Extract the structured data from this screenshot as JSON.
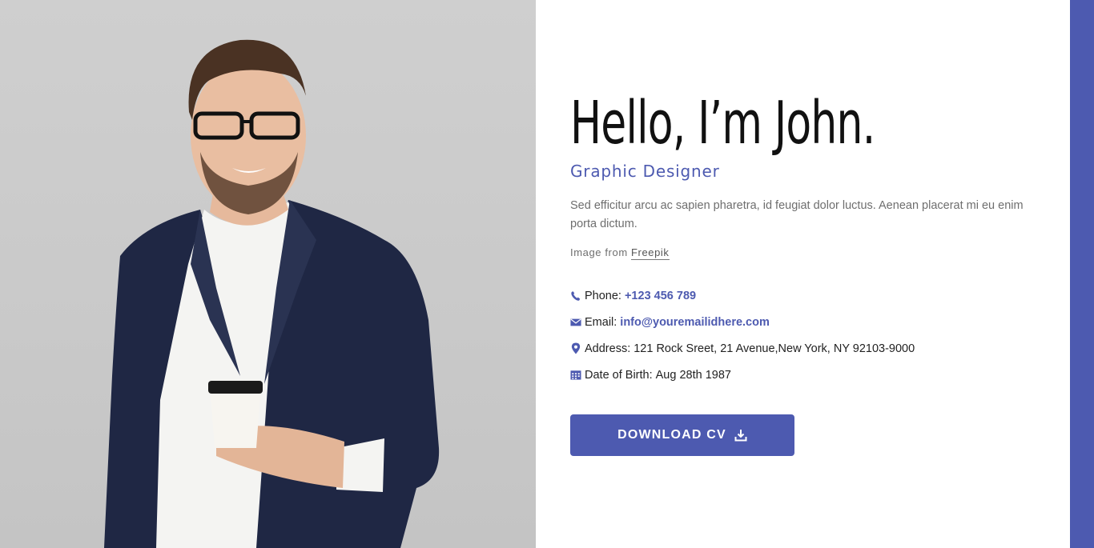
{
  "hero": {
    "title": "Hello, I’m John.",
    "subtitle": "Graphic Designer",
    "description": "Sed efficitur arcu ac sapien pharetra, id feugiat dolor luctus. Aenean placerat mi eu enim porta dictum.",
    "credit_prefix": "Image from",
    "credit_link": "Freepik"
  },
  "contact": {
    "phone_label": "Phone:",
    "phone_value": "+123 456 789",
    "email_label": "Email:",
    "email_value": "info@youremailidhere.com",
    "address_label": "Address:",
    "address_value": "121 Rock Sreet, 21 Avenue,New York, NY 92103-9000",
    "dob_label": "Date of Birth:",
    "dob_value": "Aug 28th 1987"
  },
  "actions": {
    "download_label": "DOWNLOAD CV"
  },
  "icons": {
    "phone": "phone-icon",
    "email": "envelope-icon",
    "address": "map-pin-icon",
    "dob": "calendar-icon",
    "download": "download-icon"
  },
  "colors": {
    "accent": "#4d5ab0",
    "photo_bg": "#cacaca",
    "title": "#111111",
    "body_text": "#6e6e6e"
  }
}
